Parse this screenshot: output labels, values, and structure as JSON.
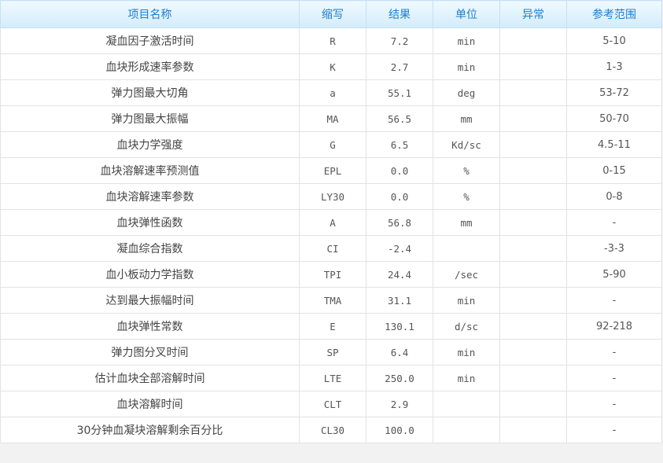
{
  "table": {
    "headers": [
      "项目名称",
      "缩写",
      "结果",
      "单位",
      "异常",
      "参考范围"
    ],
    "rows": [
      {
        "name": "凝血因子激活时间",
        "abbr": "R",
        "result": "7.2",
        "unit": "min",
        "abnormal": "",
        "range": "5-10"
      },
      {
        "name": "血块形成速率参数",
        "abbr": "K",
        "result": "2.7",
        "unit": "min",
        "abnormal": "",
        "range": "1-3"
      },
      {
        "name": "弹力图最大切角",
        "abbr": "a",
        "result": "55.1",
        "unit": "deg",
        "abnormal": "",
        "range": "53-72"
      },
      {
        "name": "弹力图最大振幅",
        "abbr": "MA",
        "result": "56.5",
        "unit": "mm",
        "abnormal": "",
        "range": "50-70"
      },
      {
        "name": "血块力学强度",
        "abbr": "G",
        "result": "6.5",
        "unit": "Kd/sc",
        "abnormal": "",
        "range": "4.5-11"
      },
      {
        "name": "血块溶解速率预测值",
        "abbr": "EPL",
        "result": "0.0",
        "unit": "%",
        "abnormal": "",
        "range": "0-15"
      },
      {
        "name": "血块溶解速率参数",
        "abbr": "LY30",
        "result": "0.0",
        "unit": "%",
        "abnormal": "",
        "range": "0-8"
      },
      {
        "name": "血块弹性函数",
        "abbr": "A",
        "result": "56.8",
        "unit": "mm",
        "abnormal": "",
        "range": "-"
      },
      {
        "name": "凝血综合指数",
        "abbr": "CI",
        "result": "-2.4",
        "unit": "",
        "abnormal": "",
        "range": "-3-3"
      },
      {
        "name": "血小板动力学指数",
        "abbr": "TPI",
        "result": "24.4",
        "unit": "/sec",
        "abnormal": "",
        "range": "5-90"
      },
      {
        "name": "达到最大振幅时间",
        "abbr": "TMA",
        "result": "31.1",
        "unit": "min",
        "abnormal": "",
        "range": "-"
      },
      {
        "name": "血块弹性常数",
        "abbr": "E",
        "result": "130.1",
        "unit": "d/sc",
        "abnormal": "",
        "range": "92-218"
      },
      {
        "name": "弹力图分叉时间",
        "abbr": "SP",
        "result": "6.4",
        "unit": "min",
        "abnormal": "",
        "range": "-"
      },
      {
        "name": "估计血块全部溶解时间",
        "abbr": "LTE",
        "result": "250.0",
        "unit": "min",
        "abnormal": "",
        "range": "-"
      },
      {
        "name": "血块溶解时间",
        "abbr": "CLT",
        "result": "2.9",
        "unit": "",
        "abnormal": "",
        "range": "-"
      },
      {
        "name": "30分钟血凝块溶解剩余百分比",
        "abbr": "CL30",
        "result": "100.0",
        "unit": "",
        "abnormal": "",
        "range": "-"
      }
    ]
  },
  "colors": {
    "header_text": "#1e7fd0",
    "header_bg_top": "#f0f9ff",
    "header_bg_bottom": "#d3ecfb",
    "cell_border": "#e3e3e3",
    "page_bg": "#f2f2f2"
  }
}
